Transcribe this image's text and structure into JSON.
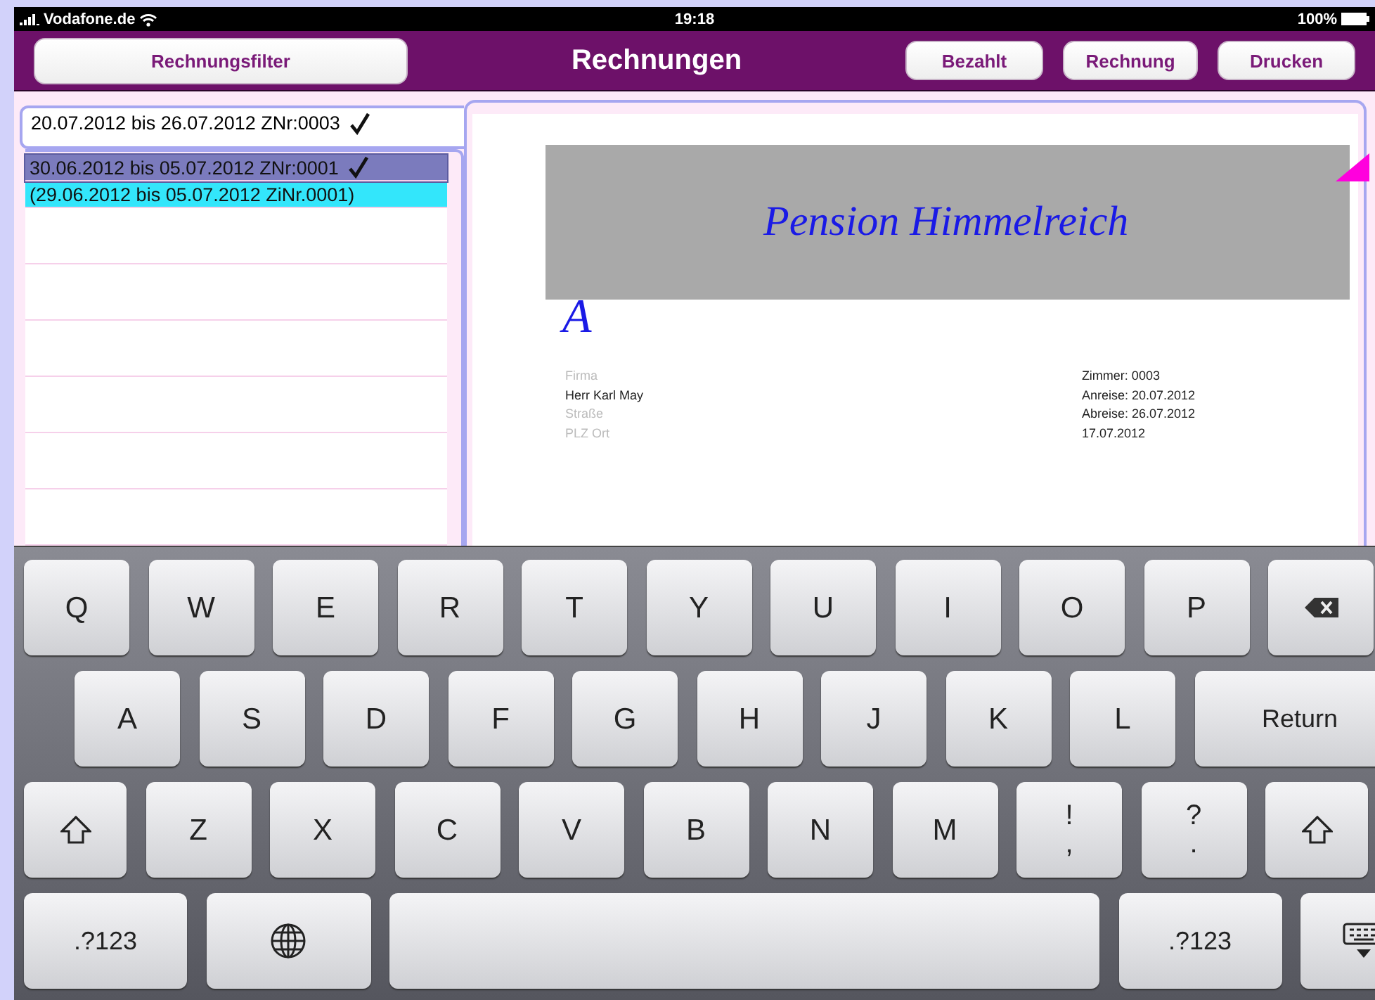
{
  "status_bar": {
    "carrier": "Vodafone.de",
    "time": "19:18",
    "battery": "100%"
  },
  "nav_bar": {
    "filter_button": "Rechnungsfilter",
    "title": "Rechnungen",
    "buttons": [
      "Bezahlt",
      "Rechnung",
      "Drucken"
    ]
  },
  "current_invoice": {
    "text": "20.07.2012 bis 26.07.2012 ZNr:0003",
    "checked": true
  },
  "invoice_list": [
    {
      "text": "30.06.2012 bis 05.07.2012 ZNr:0001",
      "checked": true,
      "selected": true,
      "color": "#7b7bbd"
    },
    {
      "text": "(29.06.2012 bis 05.07.2012 ZiNr.0001)",
      "checked": false,
      "selected": false,
      "color": "#33e6fb"
    }
  ],
  "document": {
    "letterhead": "Pension Himmelreich",
    "initial": "A",
    "address": [
      {
        "placeholder": "Firma"
      },
      {
        "value": "Herr Karl May"
      },
      {
        "placeholder": "Straße"
      },
      {
        "placeholder": "PLZ Ort"
      }
    ],
    "details": [
      "Zimmer: 0003",
      "Anreise: 20.07.2012",
      "Abreise: 26.07.2012",
      "17.07.2012"
    ]
  },
  "keyboard": [
    [
      {
        "kind": "letter",
        "label": "Q"
      },
      {
        "kind": "letter",
        "label": "W"
      },
      {
        "kind": "letter",
        "label": "E"
      },
      {
        "kind": "letter",
        "label": "R"
      },
      {
        "kind": "letter",
        "label": "T"
      },
      {
        "kind": "letter",
        "label": "Y"
      },
      {
        "kind": "letter",
        "label": "U"
      },
      {
        "kind": "letter",
        "label": "I"
      },
      {
        "kind": "letter",
        "label": "O"
      },
      {
        "kind": "letter",
        "label": "P"
      },
      {
        "kind": "backspace"
      }
    ],
    [
      {
        "kind": "letter",
        "label": "A"
      },
      {
        "kind": "letter",
        "label": "S"
      },
      {
        "kind": "letter",
        "label": "D"
      },
      {
        "kind": "letter",
        "label": "F"
      },
      {
        "kind": "letter",
        "label": "G"
      },
      {
        "kind": "letter",
        "label": "H"
      },
      {
        "kind": "letter",
        "label": "J"
      },
      {
        "kind": "letter",
        "label": "K"
      },
      {
        "kind": "letter",
        "label": "L"
      },
      {
        "kind": "return",
        "label": "Return"
      }
    ],
    [
      {
        "kind": "shift"
      },
      {
        "kind": "letter",
        "label": "Z"
      },
      {
        "kind": "letter",
        "label": "X"
      },
      {
        "kind": "letter",
        "label": "C"
      },
      {
        "kind": "letter",
        "label": "V"
      },
      {
        "kind": "letter",
        "label": "B"
      },
      {
        "kind": "letter",
        "label": "N"
      },
      {
        "kind": "letter",
        "label": "M"
      },
      {
        "kind": "dual",
        "label": "!",
        "sub": ","
      },
      {
        "kind": "dual",
        "label": "?",
        "sub": "."
      },
      {
        "kind": "shift"
      }
    ],
    [
      {
        "kind": "numbers",
        "label": ".?123"
      },
      {
        "kind": "globe"
      },
      {
        "kind": "space"
      },
      {
        "kind": "numbers",
        "label": ".?123"
      },
      {
        "kind": "hide"
      }
    ]
  ]
}
